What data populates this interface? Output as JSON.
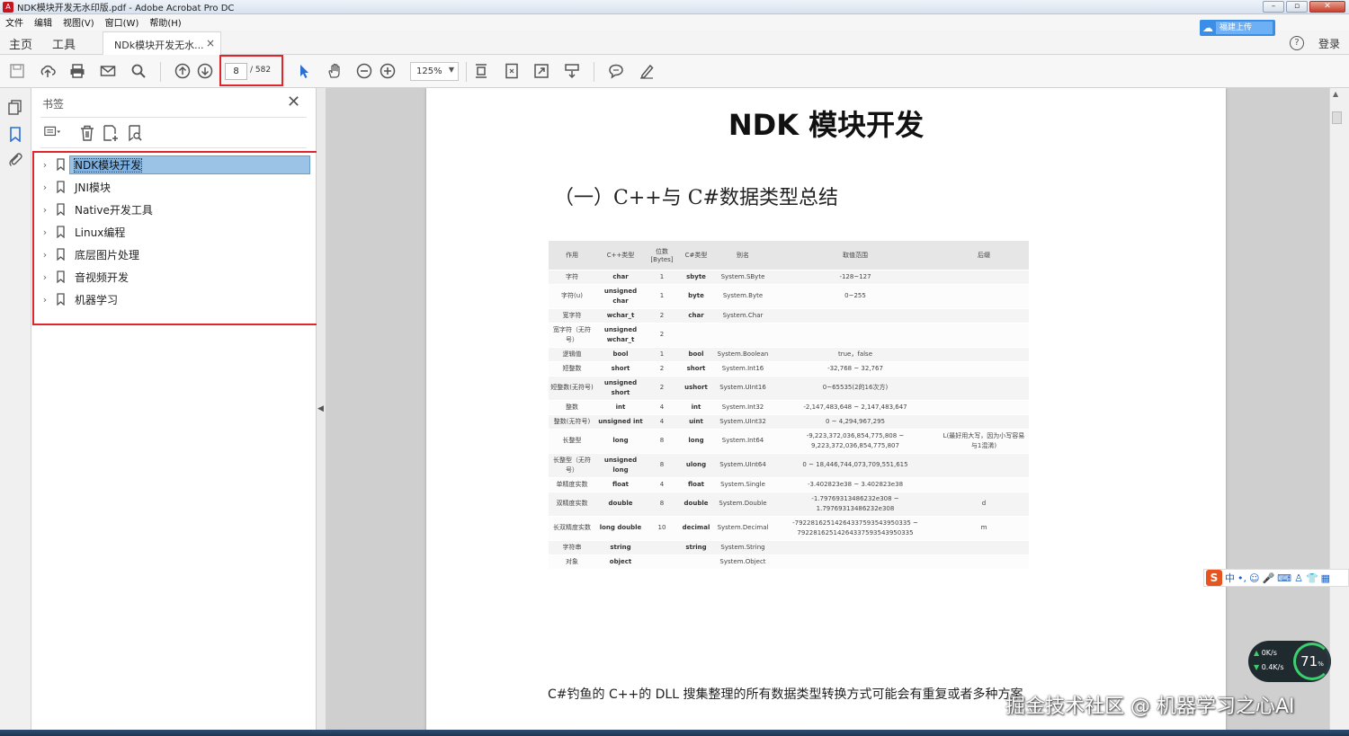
{
  "window": {
    "title": "NDK模块开发无水印版.pdf - Adobe Acrobat Pro DC"
  },
  "menubar": {
    "items": [
      "文件",
      "编辑",
      "视图(V)",
      "窗口(W)",
      "帮助(H)"
    ]
  },
  "tabs": {
    "home": "主页",
    "tools": "工具",
    "document": "NDk模块开发无水...",
    "close": "×"
  },
  "account": {
    "cloud_label": "福建上传",
    "login": "登录",
    "help": "?"
  },
  "toolbar": {
    "page_current": "8",
    "page_total": "/ 582",
    "zoom": "125%"
  },
  "bookmarks": {
    "title": "书签",
    "items": [
      "NDK模块开发",
      "JNI模块",
      "Native开发工具",
      "Linux编程",
      "底层图片处理",
      "音视频开发",
      "机器学习"
    ],
    "selected_index": 0
  },
  "document": {
    "title": "NDK 模块开发",
    "section": "（一）C++与 C#数据类型总结",
    "table": {
      "headers": [
        "作用",
        "C++类型",
        "位数\n[Bytes]",
        "C#类型",
        "别名",
        "取值范围",
        "后缀"
      ],
      "rows": [
        [
          "字符",
          "char",
          "1",
          "sbyte",
          "System.SByte",
          "-128~127",
          ""
        ],
        [
          "字符(u)",
          "unsigned char",
          "1",
          "byte",
          "System.Byte",
          "0~255",
          ""
        ],
        [
          "宽字符",
          "wchar_t",
          "2",
          "char",
          "System.Char",
          "",
          ""
        ],
        [
          "宽字符（无符号）",
          "unsigned wchar_t",
          "2",
          "",
          "",
          "",
          ""
        ],
        [
          "逻辑值",
          "bool",
          "1",
          "bool",
          "System.Boolean",
          "true，false",
          ""
        ],
        [
          "短整数",
          "short",
          "2",
          "short",
          "System.Int16",
          "-32,768 ~ 32,767",
          ""
        ],
        [
          "短整数(无符号)",
          "unsigned short",
          "2",
          "ushort",
          "System.UInt16",
          "0~65535(2的16次方)",
          ""
        ],
        [
          "整数",
          "int",
          "4",
          "int",
          "System.Int32",
          "-2,147,483,648 ~ 2,147,483,647",
          ""
        ],
        [
          "整数(无符号)",
          "unsigned int",
          "4",
          "uint",
          "System.UInt32",
          "0 ~ 4,294,967,295",
          ""
        ],
        [
          "长整型",
          "long",
          "8",
          "long",
          "System.Int64",
          "-9,223,372,036,854,775,808 ~ 9,223,372,036,854,775,807",
          "L(最好用大写，因为小写容易与1混淆)"
        ],
        [
          "长整型（无符号）",
          "unsigned long",
          "8",
          "ulong",
          "System.UInt64",
          "0 ~ 18,446,744,073,709,551,615",
          ""
        ],
        [
          "单精度实数",
          "float",
          "4",
          "float",
          "System.Single",
          "-3.402823e38 ~ 3.402823e38",
          ""
        ],
        [
          "双精度实数",
          "double",
          "8",
          "double",
          "System.Double",
          "-1.79769313486232e308 ~ 1.79769313486232e308",
          "d"
        ],
        [
          "长双精度实数",
          "long double",
          "10",
          "decimal",
          "System.Decimal",
          "-79228162514264337593543950335 ~ 79228162514264337593543950335",
          "m"
        ],
        [
          "字符串",
          "string",
          "",
          "string",
          "System.String",
          "",
          ""
        ],
        [
          "对象",
          "object",
          "",
          "",
          "System.Object",
          "",
          ""
        ]
      ]
    },
    "footer_text": "C#钓鱼的 C++的 DLL 搜集整理的所有数据类型转换方式可能会有重复或者多种方案"
  },
  "ime": {
    "logo": "S",
    "label": "中"
  },
  "network": {
    "up": "0K/s",
    "down": "0.4K/s",
    "percent": "71",
    "percent_unit": "%"
  },
  "watermark": "掘金技术社区 @ 机器学习之心AI",
  "colors": {
    "highlight_box": "#e0262c",
    "selection": "#9ac3e6",
    "accent": "#3a8ee6"
  }
}
